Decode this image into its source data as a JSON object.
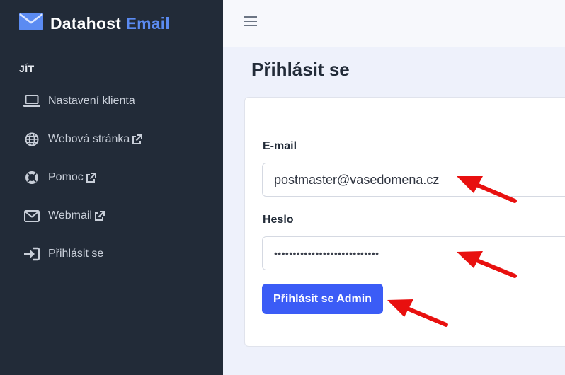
{
  "brand": {
    "name": "Datahost",
    "accent": "Email"
  },
  "sidebar": {
    "heading": "JÍT",
    "items": [
      {
        "label": "Nastavení klienta",
        "icon": "laptop-icon",
        "external": false
      },
      {
        "label": "Webová stránka",
        "icon": "globe-icon",
        "external": true
      },
      {
        "label": "Pomoc",
        "icon": "lifebuoy-icon",
        "external": true
      },
      {
        "label": "Webmail",
        "icon": "envelope-icon",
        "external": true
      },
      {
        "label": "Přihlásit se",
        "icon": "sign-in-icon",
        "external": false
      }
    ]
  },
  "topbar": {
    "menu_icon": "hamburger-icon"
  },
  "page": {
    "title": "Přihlásit se"
  },
  "form": {
    "email_label": "E-mail",
    "email_value": "postmaster@vasedomena.cz",
    "password_label": "Heslo",
    "password_value": "••••••••••••••••••••••••••••",
    "submit_label": "Přihlásit se Admin"
  },
  "colors": {
    "sidebar_bg": "#222b38",
    "brand_accent": "#5b8bf2",
    "primary_button": "#3b5cf6",
    "annotation_arrow": "#e8100f"
  }
}
